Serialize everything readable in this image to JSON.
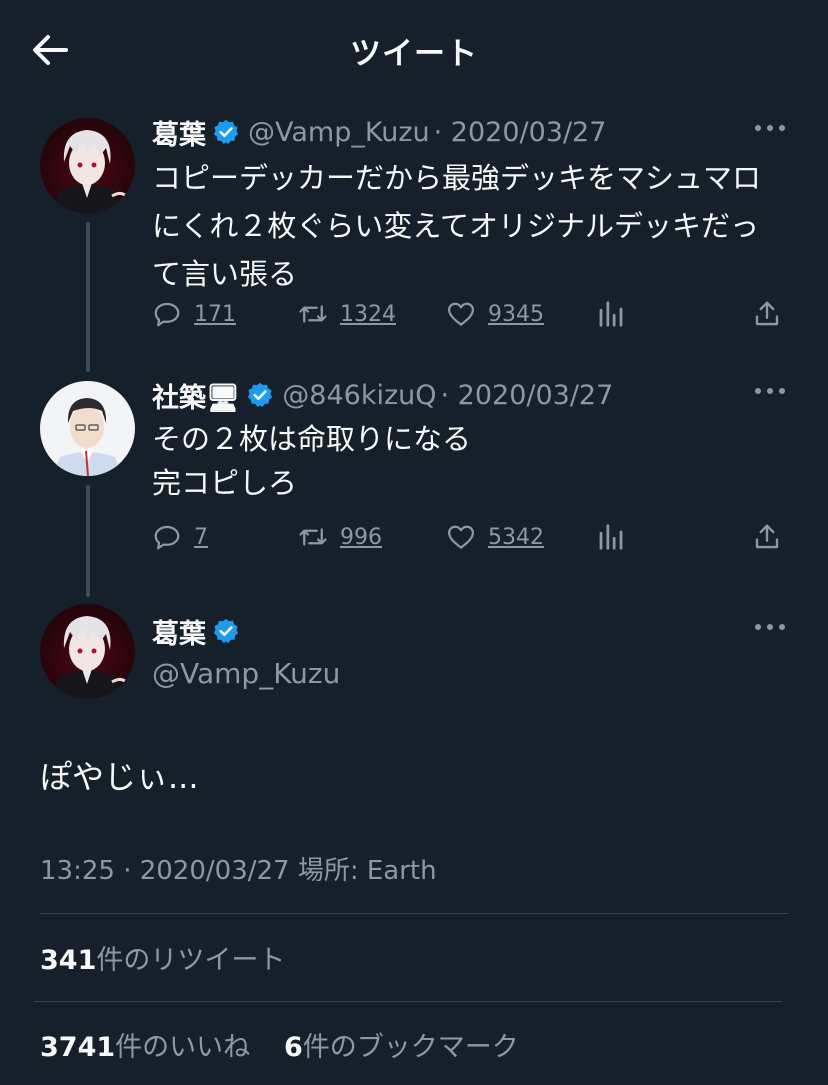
{
  "header": {
    "title": "ツイート"
  },
  "tweets": [
    {
      "name": "葛葉",
      "handle": "@Vamp_Kuzu",
      "date": "· 2020/03/27",
      "lines": [
        "コピーデッカーだから最強デッキをマシュマロ",
        "にくれ２枚ぐらい変えてオリジナルデッキだっ",
        "て言い張る"
      ],
      "replies": "171",
      "retweets": "1324",
      "likes": "9345"
    },
    {
      "name": "社築🖥",
      "handle": "@846kizuQ",
      "date": "· 2020/03/27",
      "lines": [
        "その２枚は命取りになる",
        "完コピしろ"
      ],
      "replies": "7",
      "retweets": "996",
      "likes": "5342"
    }
  ],
  "main": {
    "name": "葛葉",
    "handle": "@Vamp_Kuzu",
    "text": "ぽやじぃ...",
    "meta": "13:25 · 2020/03/27 場所: Earth",
    "retweet_count": "341",
    "retweet_label": "件のリツイート",
    "like_count": "3741",
    "like_label": "件のいいね",
    "bookmark_count": "6",
    "bookmark_label": "件のブックマーク"
  },
  "colors": {
    "background": "#15202b",
    "text": "#f7f9f9",
    "secondary": "#8b98a5",
    "verified": "#1d9bf0"
  },
  "icons": [
    "back-arrow-icon",
    "verified-badge-icon",
    "more-icon",
    "reply-icon",
    "retweet-icon",
    "like-icon",
    "analytics-icon",
    "share-icon"
  ]
}
